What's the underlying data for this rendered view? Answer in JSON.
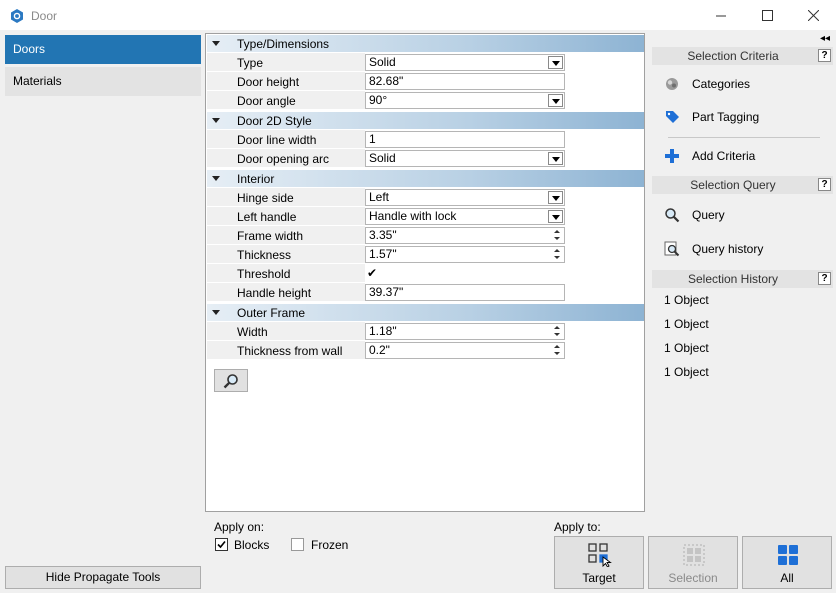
{
  "window": {
    "title": "Door",
    "minimize_icon": "minimize-icon",
    "maximize_icon": "maximize-icon",
    "close_icon": "close-icon"
  },
  "sidebar": {
    "items": [
      {
        "label": "Doors",
        "active": true
      },
      {
        "label": "Materials",
        "active": false
      }
    ],
    "hide_button": "Hide Propagate Tools"
  },
  "properties": {
    "sections": [
      {
        "title": "Type/Dimensions",
        "rows": [
          {
            "label": "Type",
            "value": "Solid",
            "control": "dropdown"
          },
          {
            "label": "Door height",
            "value": "82.68\"",
            "control": "text"
          },
          {
            "label": "Door angle",
            "value": "90°",
            "control": "dropdown"
          }
        ]
      },
      {
        "title": "Door 2D Style",
        "rows": [
          {
            "label": "Door line width",
            "value": "1",
            "control": "text"
          },
          {
            "label": "Door opening arc",
            "value": "Solid",
            "control": "dropdown"
          }
        ]
      },
      {
        "title": "Interior",
        "rows": [
          {
            "label": "Hinge side",
            "value": "Left",
            "control": "dropdown"
          },
          {
            "label": "Left handle",
            "value": "Handle with lock",
            "control": "dropdown"
          },
          {
            "label": "Frame width",
            "value": "3.35\"",
            "control": "spin"
          },
          {
            "label": "Thickness",
            "value": "1.57\"",
            "control": "spin"
          },
          {
            "label": "Threshold",
            "value": "✔",
            "control": "check"
          },
          {
            "label": "Handle height",
            "value": "39.37\"",
            "control": "text"
          }
        ]
      },
      {
        "title": "Outer Frame",
        "rows": [
          {
            "label": "Width",
            "value": "1.18\"",
            "control": "spin"
          },
          {
            "label": "Thickness from wall",
            "value": "0.2\"",
            "control": "spin"
          }
        ]
      }
    ]
  },
  "apply_on": {
    "label": "Apply on:",
    "blocks": {
      "label": "Blocks",
      "checked": true
    },
    "frozen": {
      "label": "Frozen",
      "checked": false
    }
  },
  "apply_to": {
    "label": "Apply to:",
    "buttons": [
      {
        "label": "Target",
        "enabled": true
      },
      {
        "label": "Selection",
        "enabled": false
      },
      {
        "label": "All",
        "enabled": true
      }
    ]
  },
  "right_panel": {
    "collapse_glyph": "◂◂",
    "selection_criteria": {
      "title": "Selection Criteria",
      "items": [
        {
          "label": "Categories",
          "icon": "categories-icon"
        },
        {
          "label": "Part Tagging",
          "icon": "tag-icon"
        },
        {
          "label": "Add Criteria",
          "icon": "plus-icon"
        }
      ]
    },
    "selection_query": {
      "title": "Selection Query",
      "items": [
        {
          "label": "Query",
          "icon": "search-icon"
        },
        {
          "label": "Query history",
          "icon": "query-history-icon"
        }
      ]
    },
    "selection_history": {
      "title": "Selection History",
      "items": [
        "1 Object",
        "1 Object",
        "1 Object",
        "1 Object"
      ]
    },
    "help_glyph": "?"
  },
  "colors": {
    "accent": "#2275b3",
    "section_gradient_end": "#8db3d3",
    "plus_blue": "#1e6fd6"
  }
}
